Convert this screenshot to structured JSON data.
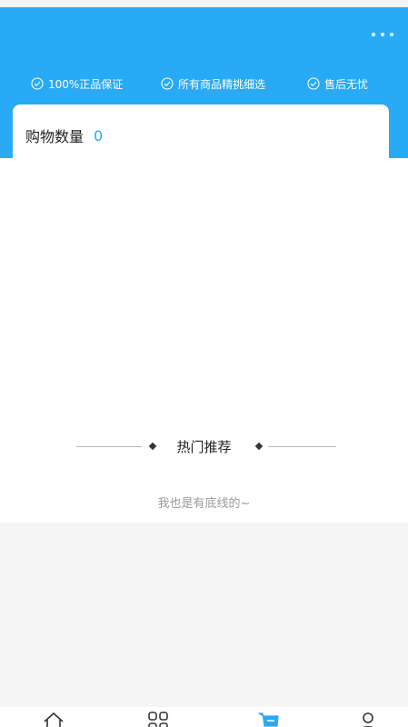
{
  "header": {
    "more_icon": "more-dots-icon",
    "guarantees": [
      {
        "label": "100%正品保证",
        "icon": "check-circle-icon"
      },
      {
        "label": "所有商品精挑细选",
        "icon": "check-circle-icon"
      },
      {
        "label": "售后无忧",
        "icon": "check-circle-icon"
      }
    ],
    "accent_color": "#29aaf4"
  },
  "cart": {
    "count_label": "购物数量",
    "count_value": "0"
  },
  "recommend": {
    "title": "热门推荐",
    "bottom_note": "我也是有底线的~"
  },
  "tabbar": {
    "tabs": [
      {
        "icon": "home-icon",
        "active": false
      },
      {
        "icon": "category-icon",
        "active": false
      },
      {
        "icon": "cart-icon",
        "active": true
      },
      {
        "icon": "user-icon",
        "active": false
      }
    ]
  }
}
